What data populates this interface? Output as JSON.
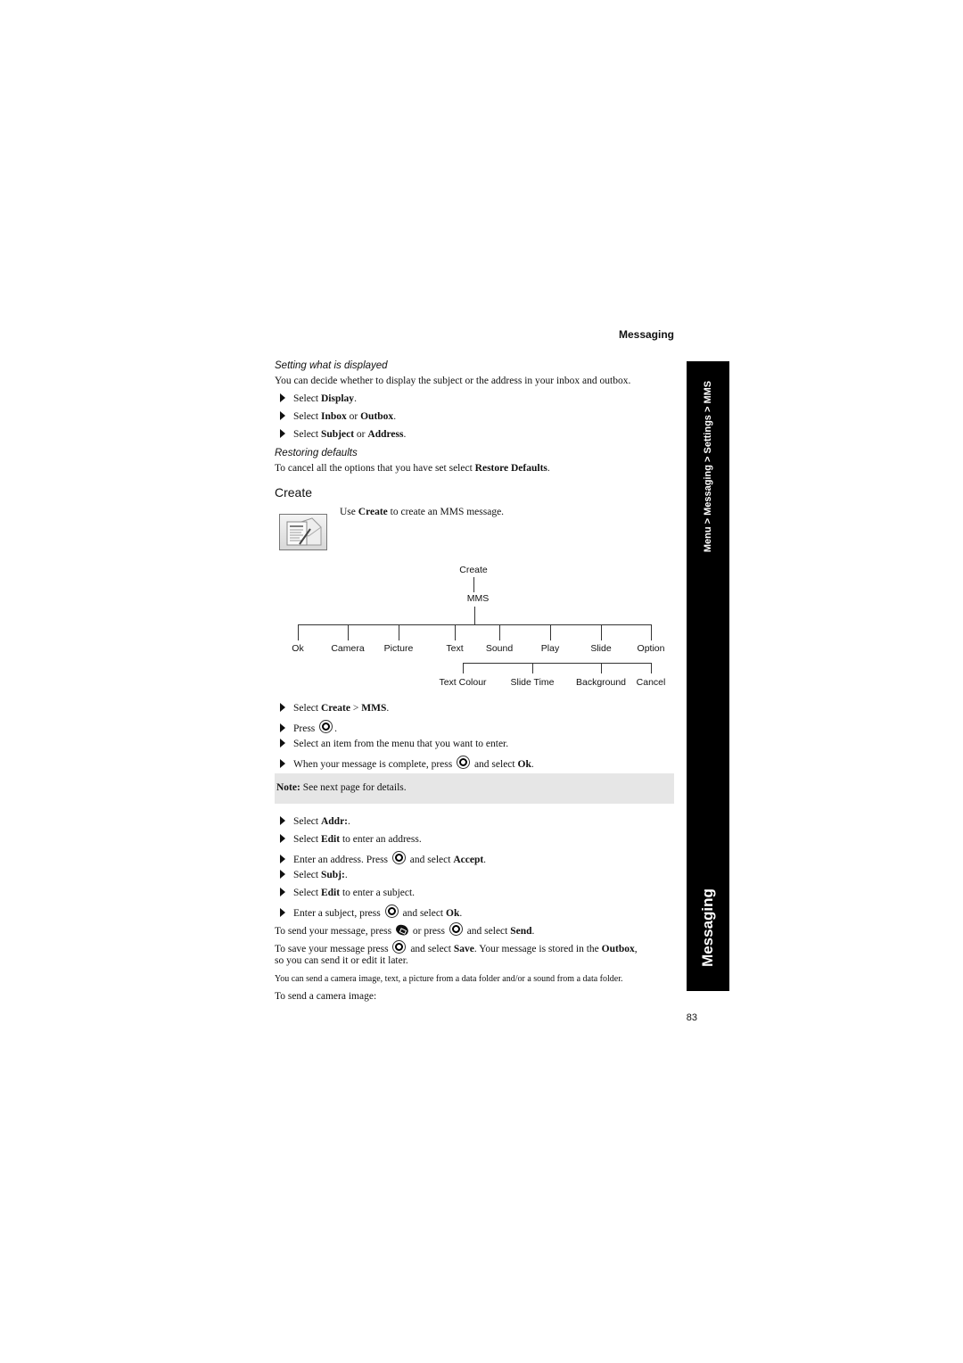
{
  "header": {
    "section": "Messaging"
  },
  "settings_display": {
    "heading": "Setting what is displayed",
    "intro": "You can decide whether to display the subject or the address in your inbox and outbox.",
    "steps": [
      {
        "pre": "Select ",
        "b1": "Display",
        "mid": "",
        "b2": "",
        "post": "."
      },
      {
        "pre": "Select ",
        "b1": "Inbox",
        "mid": " or ",
        "b2": "Outbox",
        "post": "."
      },
      {
        "pre": "Select ",
        "b1": "Subject",
        "mid": " or ",
        "b2": "Address",
        "post": "."
      }
    ]
  },
  "restoring": {
    "heading": "Restoring defaults",
    "pre": "To cancel all the options that you have set select ",
    "bold": "Restore Defaults",
    "post": "."
  },
  "create": {
    "heading": "Create",
    "icon": "mms-create-icon",
    "desc_pre": "Use ",
    "desc_bold": "Create",
    "desc_post": " to create an MMS message."
  },
  "tree": {
    "root": "Create",
    "child": "MMS",
    "level2": [
      "Ok",
      "Camera",
      "Picture",
      "Text",
      "Sound",
      "Play",
      "Slide",
      "Option"
    ],
    "level3": [
      "Text Colour",
      "Slide Time",
      "Background",
      "Cancel"
    ]
  },
  "steps_create": [
    {
      "pre": "Select ",
      "b1": "Create",
      "mid": " > ",
      "b2": "MMS",
      "post": "."
    },
    {
      "pre": "Press ",
      "icon": "center-key-icon",
      "post": "."
    },
    {
      "text": "Select an item from the menu that you want to enter."
    },
    {
      "pre": "When your message is complete,  press ",
      "icon": "center-key-icon",
      "mid": " and select ",
      "b1": "Ok",
      "post": "."
    }
  ],
  "note": {
    "label": "Note:",
    "text": " See next page for details."
  },
  "steps_address": [
    {
      "pre": "Select ",
      "b1": "Addr:",
      "post": "."
    },
    {
      "pre": "Select ",
      "b1": "Edit",
      "post": " to enter an address."
    },
    {
      "pre": "Enter an address. Press ",
      "icon": "center-key-icon",
      "mid": " and select ",
      "b1": "Accept",
      "post": "."
    },
    {
      "pre": "Select ",
      "b1": "Subj:",
      "post": "."
    },
    {
      "pre": "Select ",
      "b1": "Edit",
      "post": " to enter a subject."
    },
    {
      "pre": "Enter a subject, press ",
      "icon": "center-key-icon",
      "mid": " and select ",
      "b1": "Ok",
      "post": "."
    }
  ],
  "send": {
    "pre": "To send your message, press ",
    "icon1": "send-key-icon",
    "mid": " or press ",
    "icon2": "center-key-icon",
    "mid2": " and select ",
    "bold": "Send",
    "post": "."
  },
  "save": {
    "pre": "To save your message press ",
    "icon": "center-key-icon",
    "mid": " and select ",
    "b1": "Save",
    "mid2": ". Your message is stored in the ",
    "b2": "Outbox",
    "post": ",",
    "line2": "so you can send it or edit it later."
  },
  "camera_note": "You can send a camera image, text, a picture from a data folder and/or a sound from a data folder.",
  "camera_intro": "To send a camera image:",
  "sidebar": {
    "path": "Menu > Messaging > Settings > MMS",
    "title": "Messaging"
  },
  "page_number": "83"
}
